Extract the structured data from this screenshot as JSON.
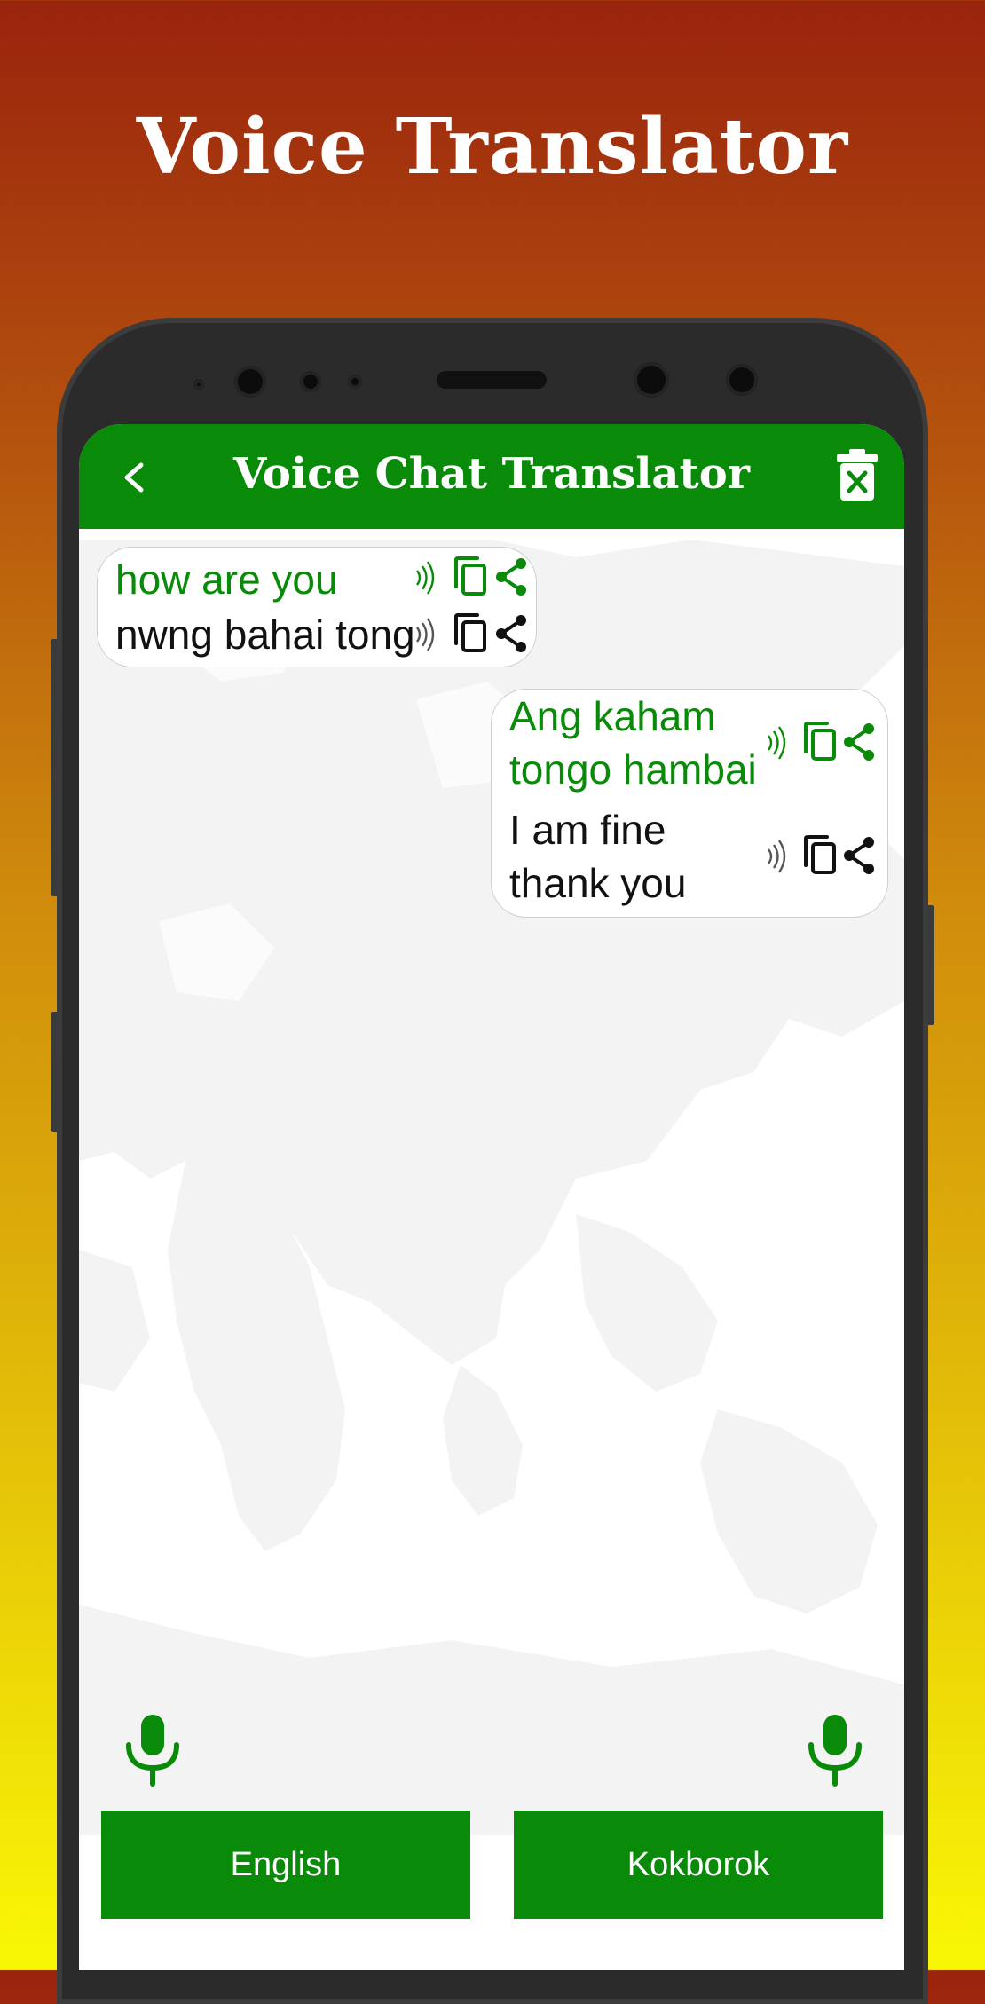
{
  "promo": {
    "title": "Voice Translator"
  },
  "appbar": {
    "title": "Voice Chat Translator"
  },
  "messages": [
    {
      "side": "left",
      "source_text": "how are you",
      "translated_text": "nwng bahai tong"
    },
    {
      "side": "right",
      "source_text": "Ang kaham\ntongo hambai",
      "translated_text": "I am fine\nthank you"
    }
  ],
  "languages": {
    "left": "English",
    "right": "Kokborok"
  },
  "icons": {
    "back": "chevron-left-icon",
    "clear": "trash-x-icon",
    "speak": "speaker-wave-icon",
    "copy": "copy-icon",
    "share": "share-icon",
    "mic": "microphone-icon"
  },
  "colors": {
    "accent": "#098a09",
    "text": "#111111",
    "bubble_border": "#cfcfcf"
  }
}
